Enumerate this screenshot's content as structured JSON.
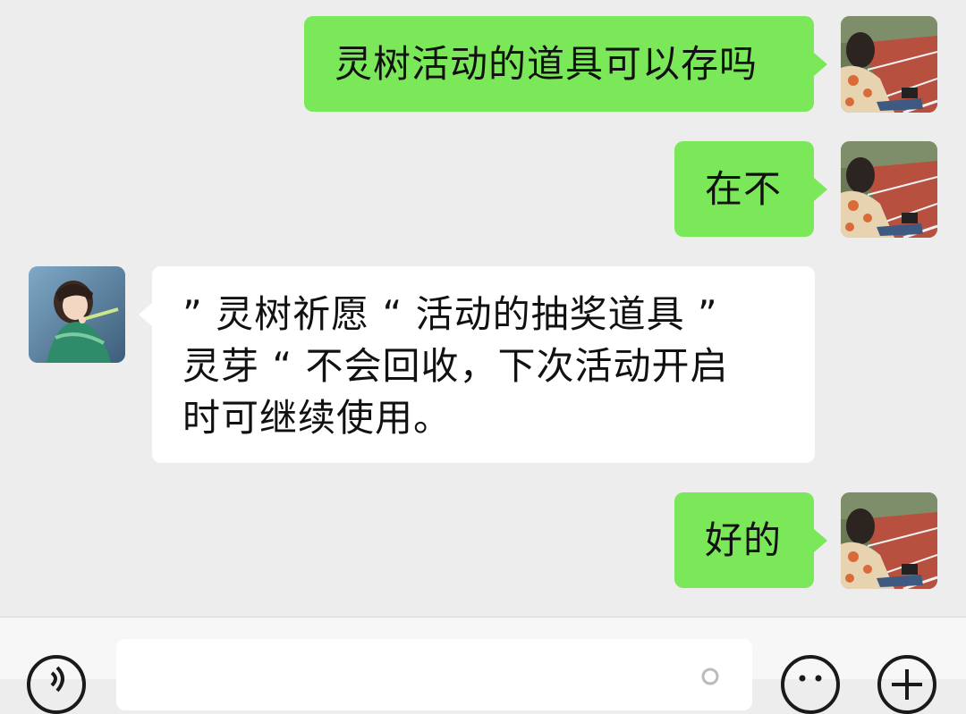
{
  "messages": [
    {
      "direction": "outgoing",
      "text": "灵树活动的道具可以存吗",
      "avatar": "self-avatar-photo"
    },
    {
      "direction": "outgoing",
      "text": "在不",
      "avatar": "self-avatar-photo"
    },
    {
      "direction": "incoming",
      "lines": [
        "” 灵树祈愿 “ 活动的抽奖道具 ”",
        "灵芽 “ 不会回收，下次活动开启",
        "时可继续使用。"
      ],
      "avatar": "contact-avatar-illustration"
    },
    {
      "direction": "outgoing",
      "text": "好的",
      "avatar": "self-avatar-photo"
    }
  ],
  "input_bar": {
    "voice_icon": "voice-icon",
    "input_value": "",
    "emoji_icon": "emoji-icon",
    "plus_icon": "plus-icon"
  },
  "colors": {
    "background": "#EDEDED",
    "outgoing_bubble": "#7BE85A",
    "incoming_bubble": "#FFFFFF",
    "input_bar": "#F7F7F7"
  }
}
